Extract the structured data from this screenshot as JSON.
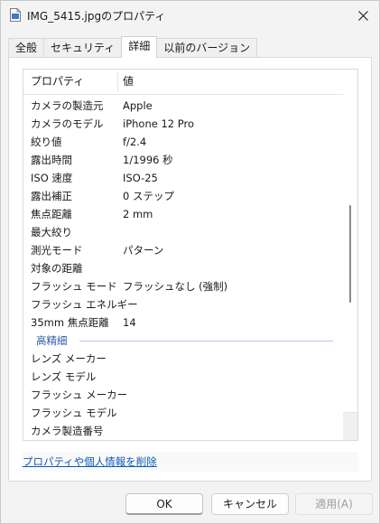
{
  "window": {
    "title": "IMG_5415.jpgのプロパティ",
    "icon": "file-icon",
    "close_icon": "close-icon"
  },
  "tabs": [
    {
      "label": "全般",
      "active": false
    },
    {
      "label": "セキュリティ",
      "active": false
    },
    {
      "label": "詳細",
      "active": true
    },
    {
      "label": "以前のバージョン",
      "active": false
    }
  ],
  "list": {
    "header": {
      "property": "プロパティ",
      "value": "値"
    },
    "rows": [
      {
        "property": "カメラの製造元",
        "value": "Apple"
      },
      {
        "property": "カメラのモデル",
        "value": "iPhone 12 Pro"
      },
      {
        "property": "絞り値",
        "value": "f/2.4"
      },
      {
        "property": "露出時間",
        "value": "1/1996 秒"
      },
      {
        "property": "ISO 速度",
        "value": "ISO-25"
      },
      {
        "property": "露出補正",
        "value": "0 ステップ"
      },
      {
        "property": "焦点距離",
        "value": "2 mm"
      },
      {
        "property": "最大絞り",
        "value": ""
      },
      {
        "property": "測光モード",
        "value": "パターン"
      },
      {
        "property": "対象の距離",
        "value": ""
      },
      {
        "property": "フラッシュ モード",
        "value": "フラッシュなし (強制)"
      },
      {
        "property": "フラッシュ エネルギー",
        "value": ""
      },
      {
        "property": "35mm 焦点距離",
        "value": "14"
      }
    ],
    "group": {
      "label": "高精細"
    },
    "group_rows": [
      {
        "property": "レンズ メーカー",
        "value": ""
      },
      {
        "property": "レンズ モデル",
        "value": ""
      },
      {
        "property": "フラッシュ メーカー",
        "value": ""
      },
      {
        "property": "フラッシュ モデル",
        "value": ""
      },
      {
        "property": "カメラ製造番号",
        "value": ""
      }
    ]
  },
  "remove_link": "プロパティや個人情報を削除",
  "buttons": {
    "ok": "OK",
    "cancel": "キャンセル",
    "apply": "適用(A)"
  },
  "colors": {
    "link": "#0b5bb8",
    "group_label": "#2a5aa8",
    "window_bg": "#f3f3f3"
  }
}
